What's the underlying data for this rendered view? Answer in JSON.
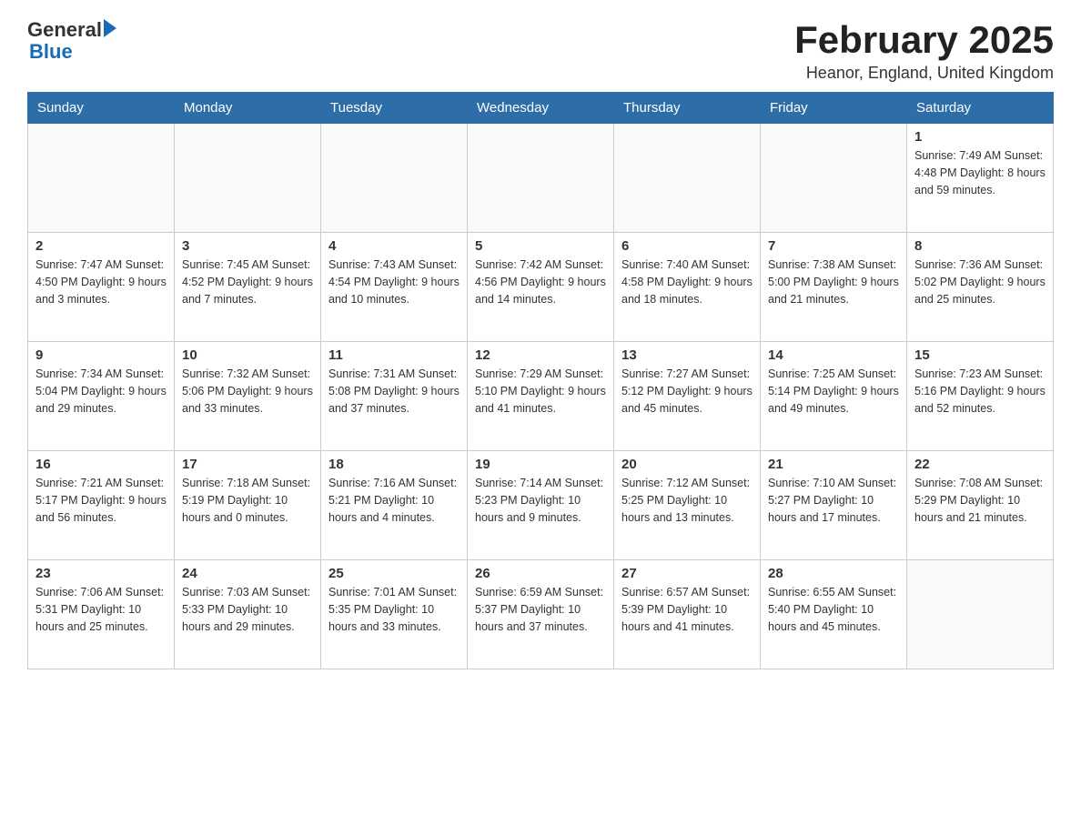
{
  "header": {
    "logo_general": "General",
    "logo_blue": "Blue",
    "month_title": "February 2025",
    "location": "Heanor, England, United Kingdom"
  },
  "weekdays": [
    "Sunday",
    "Monday",
    "Tuesday",
    "Wednesday",
    "Thursday",
    "Friday",
    "Saturday"
  ],
  "weeks": [
    {
      "days": [
        {
          "number": "",
          "info": ""
        },
        {
          "number": "",
          "info": ""
        },
        {
          "number": "",
          "info": ""
        },
        {
          "number": "",
          "info": ""
        },
        {
          "number": "",
          "info": ""
        },
        {
          "number": "",
          "info": ""
        },
        {
          "number": "1",
          "info": "Sunrise: 7:49 AM\nSunset: 4:48 PM\nDaylight: 8 hours and 59 minutes."
        }
      ]
    },
    {
      "days": [
        {
          "number": "2",
          "info": "Sunrise: 7:47 AM\nSunset: 4:50 PM\nDaylight: 9 hours and 3 minutes."
        },
        {
          "number": "3",
          "info": "Sunrise: 7:45 AM\nSunset: 4:52 PM\nDaylight: 9 hours and 7 minutes."
        },
        {
          "number": "4",
          "info": "Sunrise: 7:43 AM\nSunset: 4:54 PM\nDaylight: 9 hours and 10 minutes."
        },
        {
          "number": "5",
          "info": "Sunrise: 7:42 AM\nSunset: 4:56 PM\nDaylight: 9 hours and 14 minutes."
        },
        {
          "number": "6",
          "info": "Sunrise: 7:40 AM\nSunset: 4:58 PM\nDaylight: 9 hours and 18 minutes."
        },
        {
          "number": "7",
          "info": "Sunrise: 7:38 AM\nSunset: 5:00 PM\nDaylight: 9 hours and 21 minutes."
        },
        {
          "number": "8",
          "info": "Sunrise: 7:36 AM\nSunset: 5:02 PM\nDaylight: 9 hours and 25 minutes."
        }
      ]
    },
    {
      "days": [
        {
          "number": "9",
          "info": "Sunrise: 7:34 AM\nSunset: 5:04 PM\nDaylight: 9 hours and 29 minutes."
        },
        {
          "number": "10",
          "info": "Sunrise: 7:32 AM\nSunset: 5:06 PM\nDaylight: 9 hours and 33 minutes."
        },
        {
          "number": "11",
          "info": "Sunrise: 7:31 AM\nSunset: 5:08 PM\nDaylight: 9 hours and 37 minutes."
        },
        {
          "number": "12",
          "info": "Sunrise: 7:29 AM\nSunset: 5:10 PM\nDaylight: 9 hours and 41 minutes."
        },
        {
          "number": "13",
          "info": "Sunrise: 7:27 AM\nSunset: 5:12 PM\nDaylight: 9 hours and 45 minutes."
        },
        {
          "number": "14",
          "info": "Sunrise: 7:25 AM\nSunset: 5:14 PM\nDaylight: 9 hours and 49 minutes."
        },
        {
          "number": "15",
          "info": "Sunrise: 7:23 AM\nSunset: 5:16 PM\nDaylight: 9 hours and 52 minutes."
        }
      ]
    },
    {
      "days": [
        {
          "number": "16",
          "info": "Sunrise: 7:21 AM\nSunset: 5:17 PM\nDaylight: 9 hours and 56 minutes."
        },
        {
          "number": "17",
          "info": "Sunrise: 7:18 AM\nSunset: 5:19 PM\nDaylight: 10 hours and 0 minutes."
        },
        {
          "number": "18",
          "info": "Sunrise: 7:16 AM\nSunset: 5:21 PM\nDaylight: 10 hours and 4 minutes."
        },
        {
          "number": "19",
          "info": "Sunrise: 7:14 AM\nSunset: 5:23 PM\nDaylight: 10 hours and 9 minutes."
        },
        {
          "number": "20",
          "info": "Sunrise: 7:12 AM\nSunset: 5:25 PM\nDaylight: 10 hours and 13 minutes."
        },
        {
          "number": "21",
          "info": "Sunrise: 7:10 AM\nSunset: 5:27 PM\nDaylight: 10 hours and 17 minutes."
        },
        {
          "number": "22",
          "info": "Sunrise: 7:08 AM\nSunset: 5:29 PM\nDaylight: 10 hours and 21 minutes."
        }
      ]
    },
    {
      "days": [
        {
          "number": "23",
          "info": "Sunrise: 7:06 AM\nSunset: 5:31 PM\nDaylight: 10 hours and 25 minutes."
        },
        {
          "number": "24",
          "info": "Sunrise: 7:03 AM\nSunset: 5:33 PM\nDaylight: 10 hours and 29 minutes."
        },
        {
          "number": "25",
          "info": "Sunrise: 7:01 AM\nSunset: 5:35 PM\nDaylight: 10 hours and 33 minutes."
        },
        {
          "number": "26",
          "info": "Sunrise: 6:59 AM\nSunset: 5:37 PM\nDaylight: 10 hours and 37 minutes."
        },
        {
          "number": "27",
          "info": "Sunrise: 6:57 AM\nSunset: 5:39 PM\nDaylight: 10 hours and 41 minutes."
        },
        {
          "number": "28",
          "info": "Sunrise: 6:55 AM\nSunset: 5:40 PM\nDaylight: 10 hours and 45 minutes."
        },
        {
          "number": "",
          "info": ""
        }
      ]
    }
  ]
}
